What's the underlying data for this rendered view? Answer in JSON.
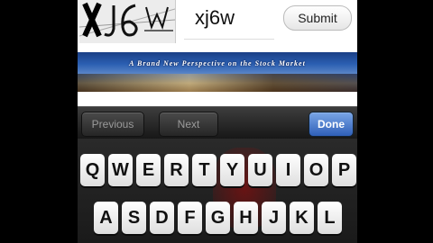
{
  "captcha": {
    "image_text": "XJ6W",
    "input_value": "xj6w",
    "submit_label": "Submit"
  },
  "banner": {
    "text": "A Brand New Perspective on the Stock Market"
  },
  "toolbar": {
    "previous_label": "Previous",
    "next_label": "Next",
    "done_label": "Done"
  },
  "keyboard": {
    "row1": [
      "Q",
      "W",
      "E",
      "R",
      "T",
      "Y",
      "U",
      "I",
      "O",
      "P"
    ],
    "row2": [
      "A",
      "S",
      "D",
      "F",
      "G",
      "H",
      "J",
      "K",
      "L"
    ]
  }
}
